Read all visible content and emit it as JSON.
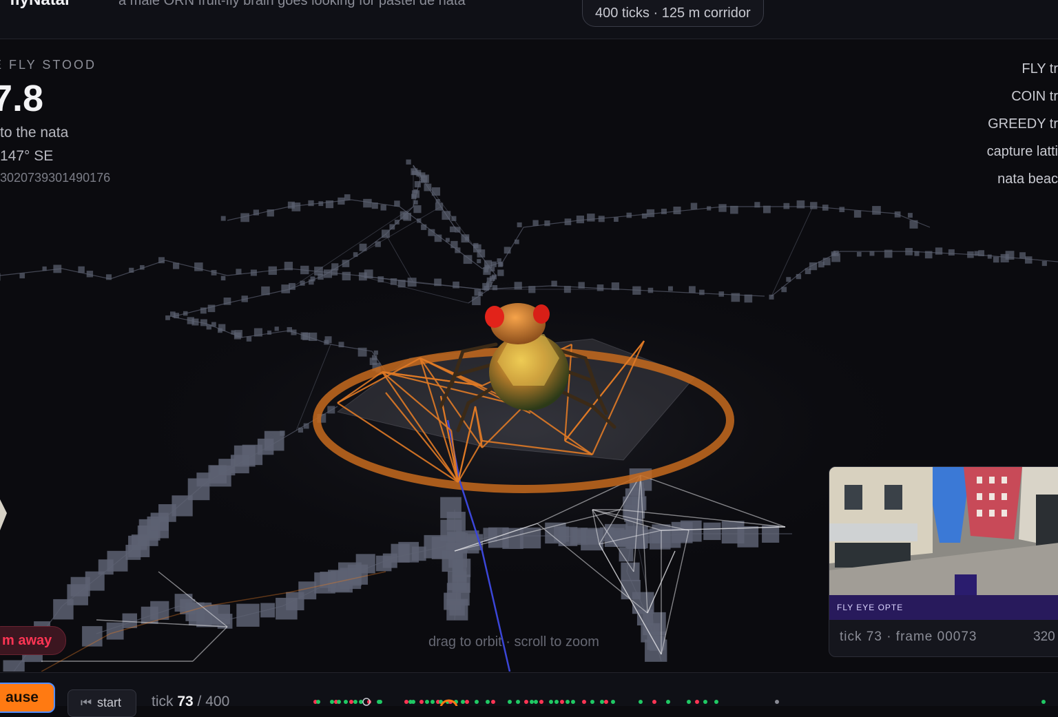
{
  "header": {
    "title": "flyNatal",
    "subtitle": "a male ORN fruit-fly brain goes looking for pastel de nata",
    "run_info": "400 ticks · 125 m corridor"
  },
  "stats": {
    "label": "E FLY STOOD",
    "value": "7.8",
    "description": "to the nata",
    "heading": "147° SE",
    "seed": "3020739301490176"
  },
  "legend": {
    "items": [
      "FLY tr",
      "COIN tr",
      "GREEDY tr",
      "capture latti",
      "nata beac"
    ]
  },
  "colors": {
    "accent": "#ff7a12",
    "fly_trail": "#e07a26",
    "coin_trail": "#e6e6ea",
    "greedy_trail": "#3b46d8",
    "lattice": "#5b6070",
    "danger": "#ff3554"
  },
  "scene": {
    "distance_badge": "m away",
    "hint": "drag to orbit · scroll to zoom"
  },
  "fly_eye": {
    "label": "FLY EYE OPTE",
    "footer": "tick 73 · frame 00073",
    "resolution": "320"
  },
  "controls": {
    "pause_label": "ause",
    "start_label": "start",
    "start_icon": "rewind-icon",
    "tick_prefix": "tick",
    "tick_current": "73",
    "tick_total": "/ 400"
  },
  "playback": {
    "tick": 73,
    "total_ticks": 400
  }
}
